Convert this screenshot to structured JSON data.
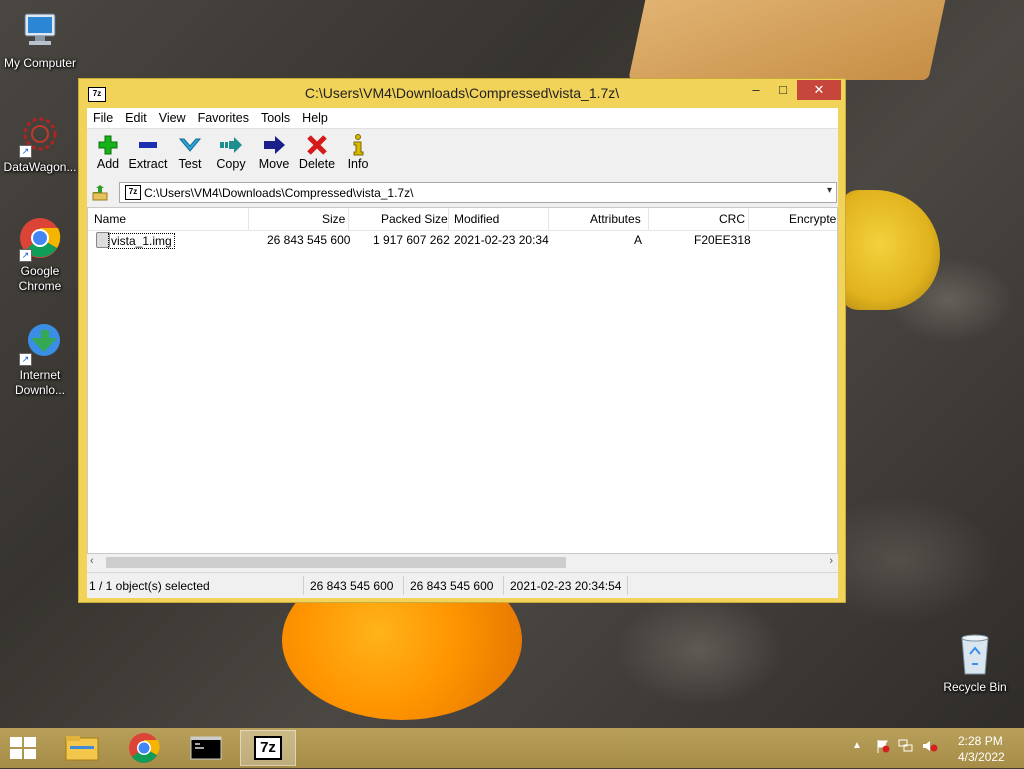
{
  "desktop": {
    "icons": [
      {
        "label": "My Computer"
      },
      {
        "label": "DataWagon..."
      },
      {
        "label": "Google Chrome"
      },
      {
        "label": "Internet Downlo..."
      },
      {
        "label": "Recycle Bin"
      }
    ]
  },
  "window": {
    "app_icon_text": "7z",
    "title": "C:\\Users\\VM4\\Downloads\\Compressed\\vista_1.7z\\",
    "caption_buttons": {
      "minimize": "–",
      "maximize": "□",
      "close": "✕"
    },
    "menu": [
      "File",
      "Edit",
      "View",
      "Favorites",
      "Tools",
      "Help"
    ],
    "toolbar": [
      {
        "label": "Add",
        "icon": "add-icon",
        "color": "#19b319"
      },
      {
        "label": "Extract",
        "icon": "extract-icon",
        "color": "#1c2fb0"
      },
      {
        "label": "Test",
        "icon": "test-icon",
        "color": "#2aa5d6"
      },
      {
        "label": "Copy",
        "icon": "copy-icon",
        "color": "#1f8e8e"
      },
      {
        "label": "Move",
        "icon": "move-icon",
        "color": "#1b1f8c"
      },
      {
        "label": "Delete",
        "icon": "delete-icon",
        "color": "#d41a1a"
      },
      {
        "label": "Info",
        "icon": "info-icon",
        "color": "#d9b800"
      }
    ],
    "address": {
      "path": "C:\\Users\\VM4\\Downloads\\Compressed\\vista_1.7z\\"
    },
    "columns": [
      "Name",
      "Size",
      "Packed Size",
      "Modified",
      "Attributes",
      "CRC",
      "Encrypte"
    ],
    "rows": [
      {
        "name": "vista_1.img",
        "size": "26 843 545 600",
        "packed_size": "1 917 607 262",
        "modified": "2021-02-23 20:34",
        "attributes": "A",
        "crc": "F20EE318"
      }
    ],
    "status": {
      "selected": "1 / 1 object(s) selected",
      "size": "26 843 545 600",
      "packed": "26 843 545 600",
      "modified": "2021-02-23 20:34:54"
    }
  },
  "taskbar": {
    "apps": [
      {
        "name": "file-explorer"
      },
      {
        "name": "google-chrome"
      },
      {
        "name": "command-prompt"
      },
      {
        "name": "7-zip",
        "label": "7z",
        "active": true
      }
    ],
    "tray": {
      "time": "2:28 PM",
      "date": "4/3/2022"
    }
  }
}
